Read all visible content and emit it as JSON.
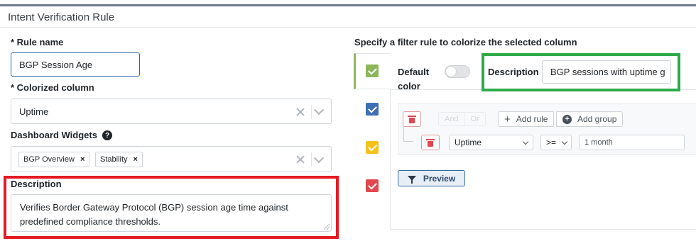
{
  "page": {
    "title": "Intent Verification Rule"
  },
  "form": {
    "rule_name_label": "* Rule name",
    "rule_name_value": "BGP Session Age",
    "colorized_column_label": "* Colorized column",
    "colorized_column_value": "Uptime",
    "dashboard_widgets_label": "Dashboard Widgets",
    "help_glyph": "?",
    "widgets": [
      {
        "label": "BGP Overview",
        "remove": "×"
      },
      {
        "label": "Stability",
        "remove": "×"
      }
    ],
    "description_label": "Description",
    "description_line1": "Verifies Border Gateway Protocol (BGP) session age time against",
    "description_line2": "predefined compliance thresholds."
  },
  "filter": {
    "header": "Specify a filter rule to colorize the selected column",
    "colors": [
      "#8db65b",
      "#3f6fb5",
      "#f5c21b",
      "#e0484f"
    ],
    "default_color_line1": "Default",
    "default_color_line2": "color",
    "default_color_on": false,
    "description_label": "Description",
    "description_value": "BGP sessions with uptime g",
    "and_label": "And",
    "or_label": "Or",
    "add_rule_label": "Add rule",
    "add_group_label": "Add group",
    "rule": {
      "field": "Uptime",
      "operator": ">=",
      "value": "1 month"
    },
    "preview_label": "Preview"
  },
  "highlight_colors": {
    "red": "#e31b23",
    "green": "#2daa4a"
  }
}
